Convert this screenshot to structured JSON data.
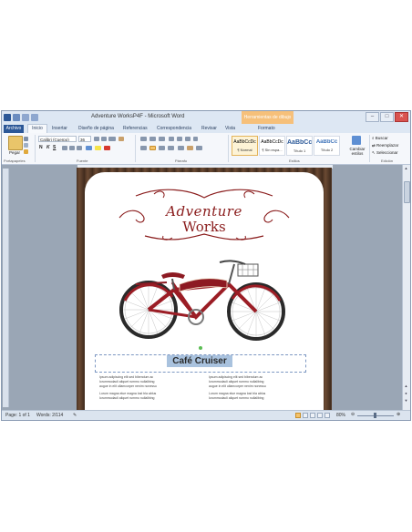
{
  "window": {
    "title": "Adventure WorksP4F  -  Microsoft Word",
    "context_tab": "Herramientas de dibujo",
    "buttons": {
      "minimize": "–",
      "maximize": "□",
      "close": "✕"
    }
  },
  "tabs": [
    "Archivo",
    "Inicio",
    "Insertar",
    "Diseño de página",
    "Referencias",
    "Correspondencia",
    "Revisar",
    "Vista",
    "Formato"
  ],
  "ribbon": {
    "clipboard": {
      "paste": "Pegar",
      "label": "Portapapeles"
    },
    "font": {
      "name": "Calibri (Cuerpo)",
      "size": "36",
      "label": "Fuente"
    },
    "paragraph": {
      "label": "Párrafo"
    },
    "styles": {
      "items": [
        {
          "sample": "AaBbCcDc",
          "name": "¶ Normal"
        },
        {
          "sample": "AaBbCcDc",
          "name": "¶ Sin espa..."
        },
        {
          "sample": "AaBbCc",
          "name": "Título 1"
        },
        {
          "sample": "AaBbCc",
          "name": "Título 2"
        }
      ],
      "change": "Cambiar estilos",
      "label": "Estilos"
    },
    "editing": {
      "find": "Buscar",
      "replace": "Reemplazar",
      "select": "Seleccionar",
      "label": "Edición"
    }
  },
  "document": {
    "logo_line1": "Adventure",
    "logo_line2": "Works",
    "caption": "Café Cruiser",
    "left_bullets": [
      "Ipsum adipiscing elit sed bibendum ac",
      "lorummodacli aliquet rummo nullalibing",
      "augue in elit ullamcorper nenim nonessu",
      "Lorum magna elue magna lost bla ablus",
      "lorummodacli aliquet rummo nullalibing"
    ],
    "right_bullets": [
      "Ipsum adipiscing elit sed bibendum ac",
      "lorummodacli aliquet rummo nullalibing",
      "augue in elit ullamcorper nenim nonessu",
      "Lorum magna elue magna lost bla ablus",
      "lorummodacli aliquet rummo nullalibing"
    ]
  },
  "statusbar": {
    "page": "Page: 1 of 1",
    "words": "Words: 2/114",
    "zoom": "80%"
  },
  "colors": {
    "accent": "#2b5797",
    "brand_red": "#8a1c1c",
    "wood": "#5a3e2b",
    "selection": "#a9c2de"
  }
}
